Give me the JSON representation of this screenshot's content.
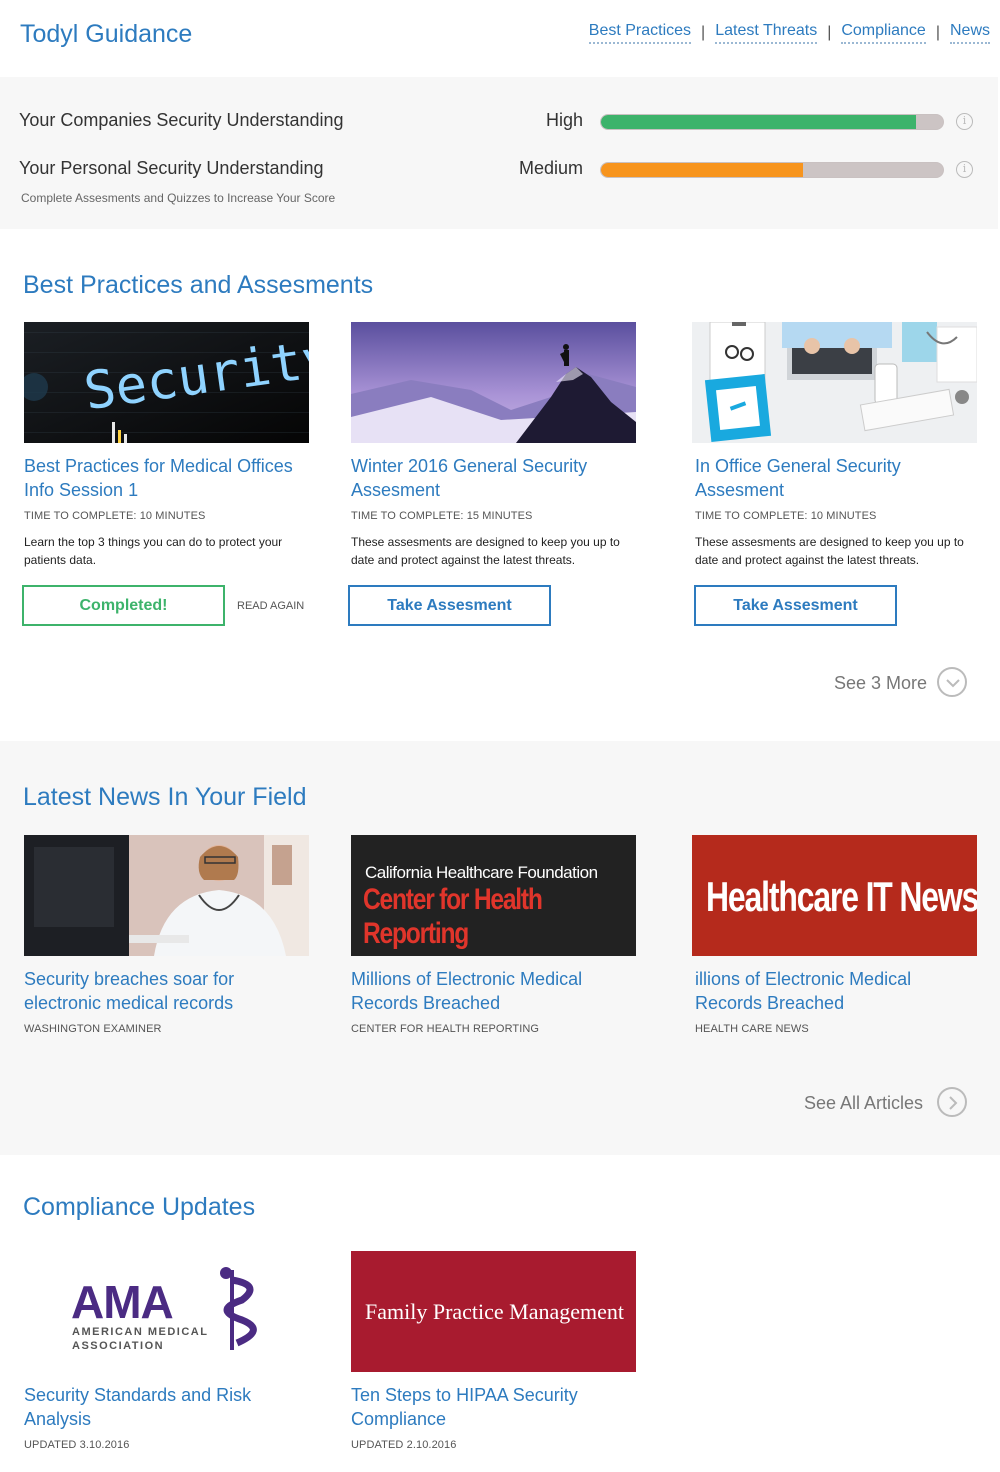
{
  "header": {
    "brand": "Todyl Guidance",
    "nav": [
      "Best Practices",
      "Latest Threats",
      "Compliance",
      "News"
    ],
    "separator": "|"
  },
  "scores": {
    "company": {
      "label": "Your Companies Security Understanding",
      "level": "High",
      "percent": 92,
      "color": "#3db36b"
    },
    "personal": {
      "label": "Your Personal Security Understanding",
      "level": "Medium",
      "percent": 59,
      "color": "#f7941d"
    },
    "hint": "Complete Assesments and Quizzes to Increase Your Score",
    "info_icon": "info-icon"
  },
  "best_practices": {
    "title": "Best Practices and Assesments",
    "cards": [
      {
        "title": "Best Practices for Medical Offices Info Session 1",
        "meta": "TIME TO COMPLETE: 10 MINUTES",
        "desc": "Learn the top 3 things you can do to protect your patients data.",
        "button": "Completed!",
        "secondary": "READ AGAIN",
        "image_text": "Security"
      },
      {
        "title": "Winter 2016 General Security Assesment",
        "meta": "TIME TO COMPLETE: 15 MINUTES",
        "desc": "These assesments are designed to keep you up to date and protect against the latest threats.",
        "button": "Take Assesment"
      },
      {
        "title": "In Office General Security Assesment",
        "meta": "TIME TO COMPLETE: 10 MINUTES",
        "desc": "These assesments are designed to keep you up to date and protect against the latest threats.",
        "button": "Take Assesment"
      }
    ],
    "more": "See 3 More",
    "more_icon": "chevron-down-icon"
  },
  "news": {
    "title": "Latest News In Your Field",
    "cards": [
      {
        "title": "Security breaches soar for electronic medical records",
        "source": "WASHINGTON EXAMINER"
      },
      {
        "title": "Millions of Electronic Medical Records Breached",
        "source": "CENTER FOR HEALTH REPORTING",
        "image_line1": "California Healthcare Foundation",
        "image_line2": "Center for Health Reporting"
      },
      {
        "title": "illions of Electronic Medical Records Breached",
        "source": "HEALTH CARE NEWS",
        "image_text_a": "Healthcare ",
        "image_text_b": "IT",
        "image_text_c": " News"
      }
    ],
    "more": "See All Articles",
    "more_icon": "chevron-right-icon"
  },
  "compliance": {
    "title": "Compliance Updates",
    "cards": [
      {
        "title": "Security Standards and Risk Analysis",
        "updated": "UPDATED 3.10.2016",
        "logo_main": "AMA",
        "logo_sub1": "AMERICAN MEDICAL",
        "logo_sub2": "ASSOCIATION"
      },
      {
        "title": "Ten Steps to HIPAA Security Compliance",
        "updated": "UPDATED 2.10.2016",
        "logo_main": "Family Practice Management"
      }
    ]
  }
}
